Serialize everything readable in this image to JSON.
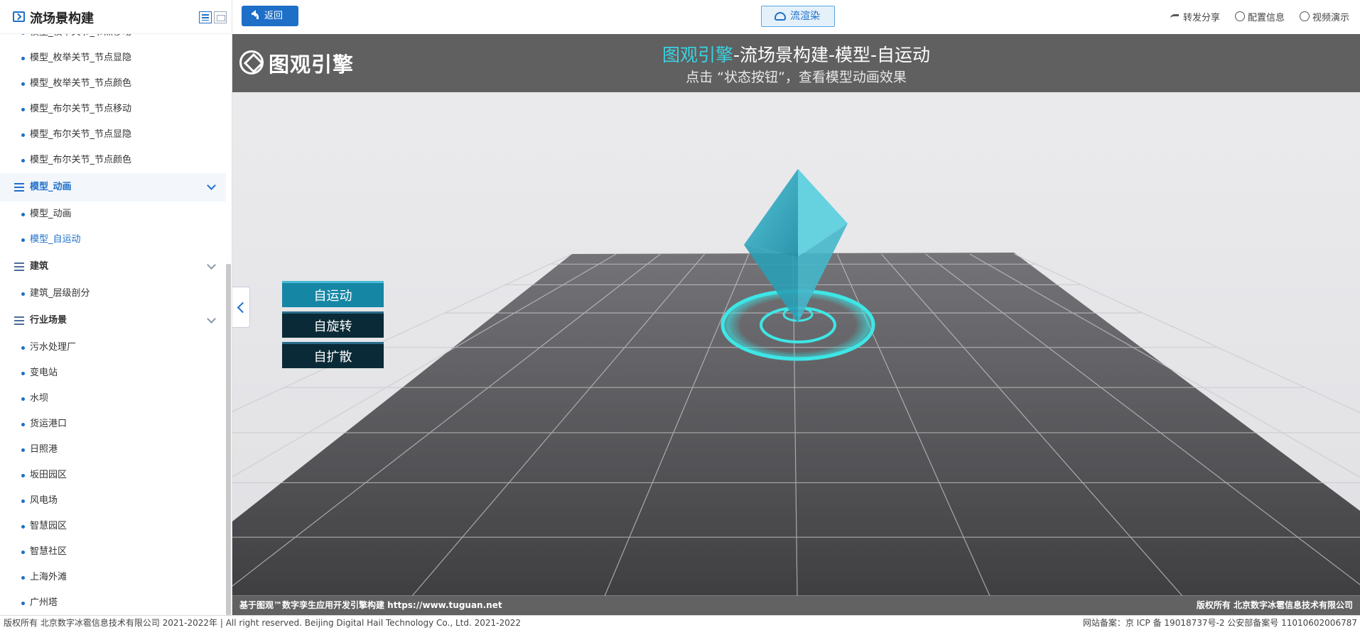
{
  "sidebar": {
    "title": "流场景构建",
    "items": [
      {
        "kind": "item",
        "label": "模型_枚举关节_节点移动"
      },
      {
        "kind": "item",
        "label": "模型_枚举关节_节点显隐"
      },
      {
        "kind": "item",
        "label": "模型_枚举关节_节点颜色"
      },
      {
        "kind": "item",
        "label": "模型_布尔关节_节点移动"
      },
      {
        "kind": "item",
        "label": "模型_布尔关节_节点显隐"
      },
      {
        "kind": "item",
        "label": "模型_布尔关节_节点颜色"
      },
      {
        "kind": "group",
        "label": "模型_动画",
        "open": true
      },
      {
        "kind": "item",
        "label": "模型_动画"
      },
      {
        "kind": "item",
        "label": "模型_自运动",
        "active": true
      },
      {
        "kind": "group",
        "label": "建筑"
      },
      {
        "kind": "item",
        "label": "建筑_层级剖分"
      },
      {
        "kind": "group",
        "label": "行业场景"
      },
      {
        "kind": "item",
        "label": "污水处理厂"
      },
      {
        "kind": "item",
        "label": "变电站"
      },
      {
        "kind": "item",
        "label": "水坝"
      },
      {
        "kind": "item",
        "label": "货运港口"
      },
      {
        "kind": "item",
        "label": "日照港"
      },
      {
        "kind": "item",
        "label": "坂田园区"
      },
      {
        "kind": "item",
        "label": "风电场"
      },
      {
        "kind": "item",
        "label": "智慧园区"
      },
      {
        "kind": "item",
        "label": "智慧社区"
      },
      {
        "kind": "item",
        "label": "上海外滩"
      },
      {
        "kind": "item",
        "label": "广州塔"
      }
    ]
  },
  "topbar": {
    "back_label": "返回",
    "render_label": "流渲染",
    "share_label": "转发分享",
    "config_label": "配置信息",
    "video_label": "视频演示"
  },
  "scene": {
    "brand": "图观引擎",
    "title_highlight": "图观引擎",
    "title_rest": "-流场景构建-模型-自运动",
    "subtitle": "点击 “状态按钮”，查看模型动画效果",
    "state_buttons": [
      "自运动",
      "自旋转",
      "自扩散"
    ],
    "active_state": "自运动",
    "footer_left": "基于图观™数字孪生应用开发引擎构建 https://www.tuguan.net",
    "footer_right": "版权所有 北京数字冰雹信息技术有限公司"
  },
  "colors": {
    "accent": "#1e6fc8",
    "cyan": "#39d3e4",
    "state_active": "#1586a4",
    "state_idle": "#0a2a37"
  },
  "page_footer": {
    "left": "版权所有 北京数字冰雹信息技术有限公司 2021-2022年 | All right reserved. Beijing Digital Hail Technology Co., Ltd. 2021-2022",
    "right": "网站备案：京 ICP 备 19018737号-2 公安部备案号 11010602006787"
  }
}
